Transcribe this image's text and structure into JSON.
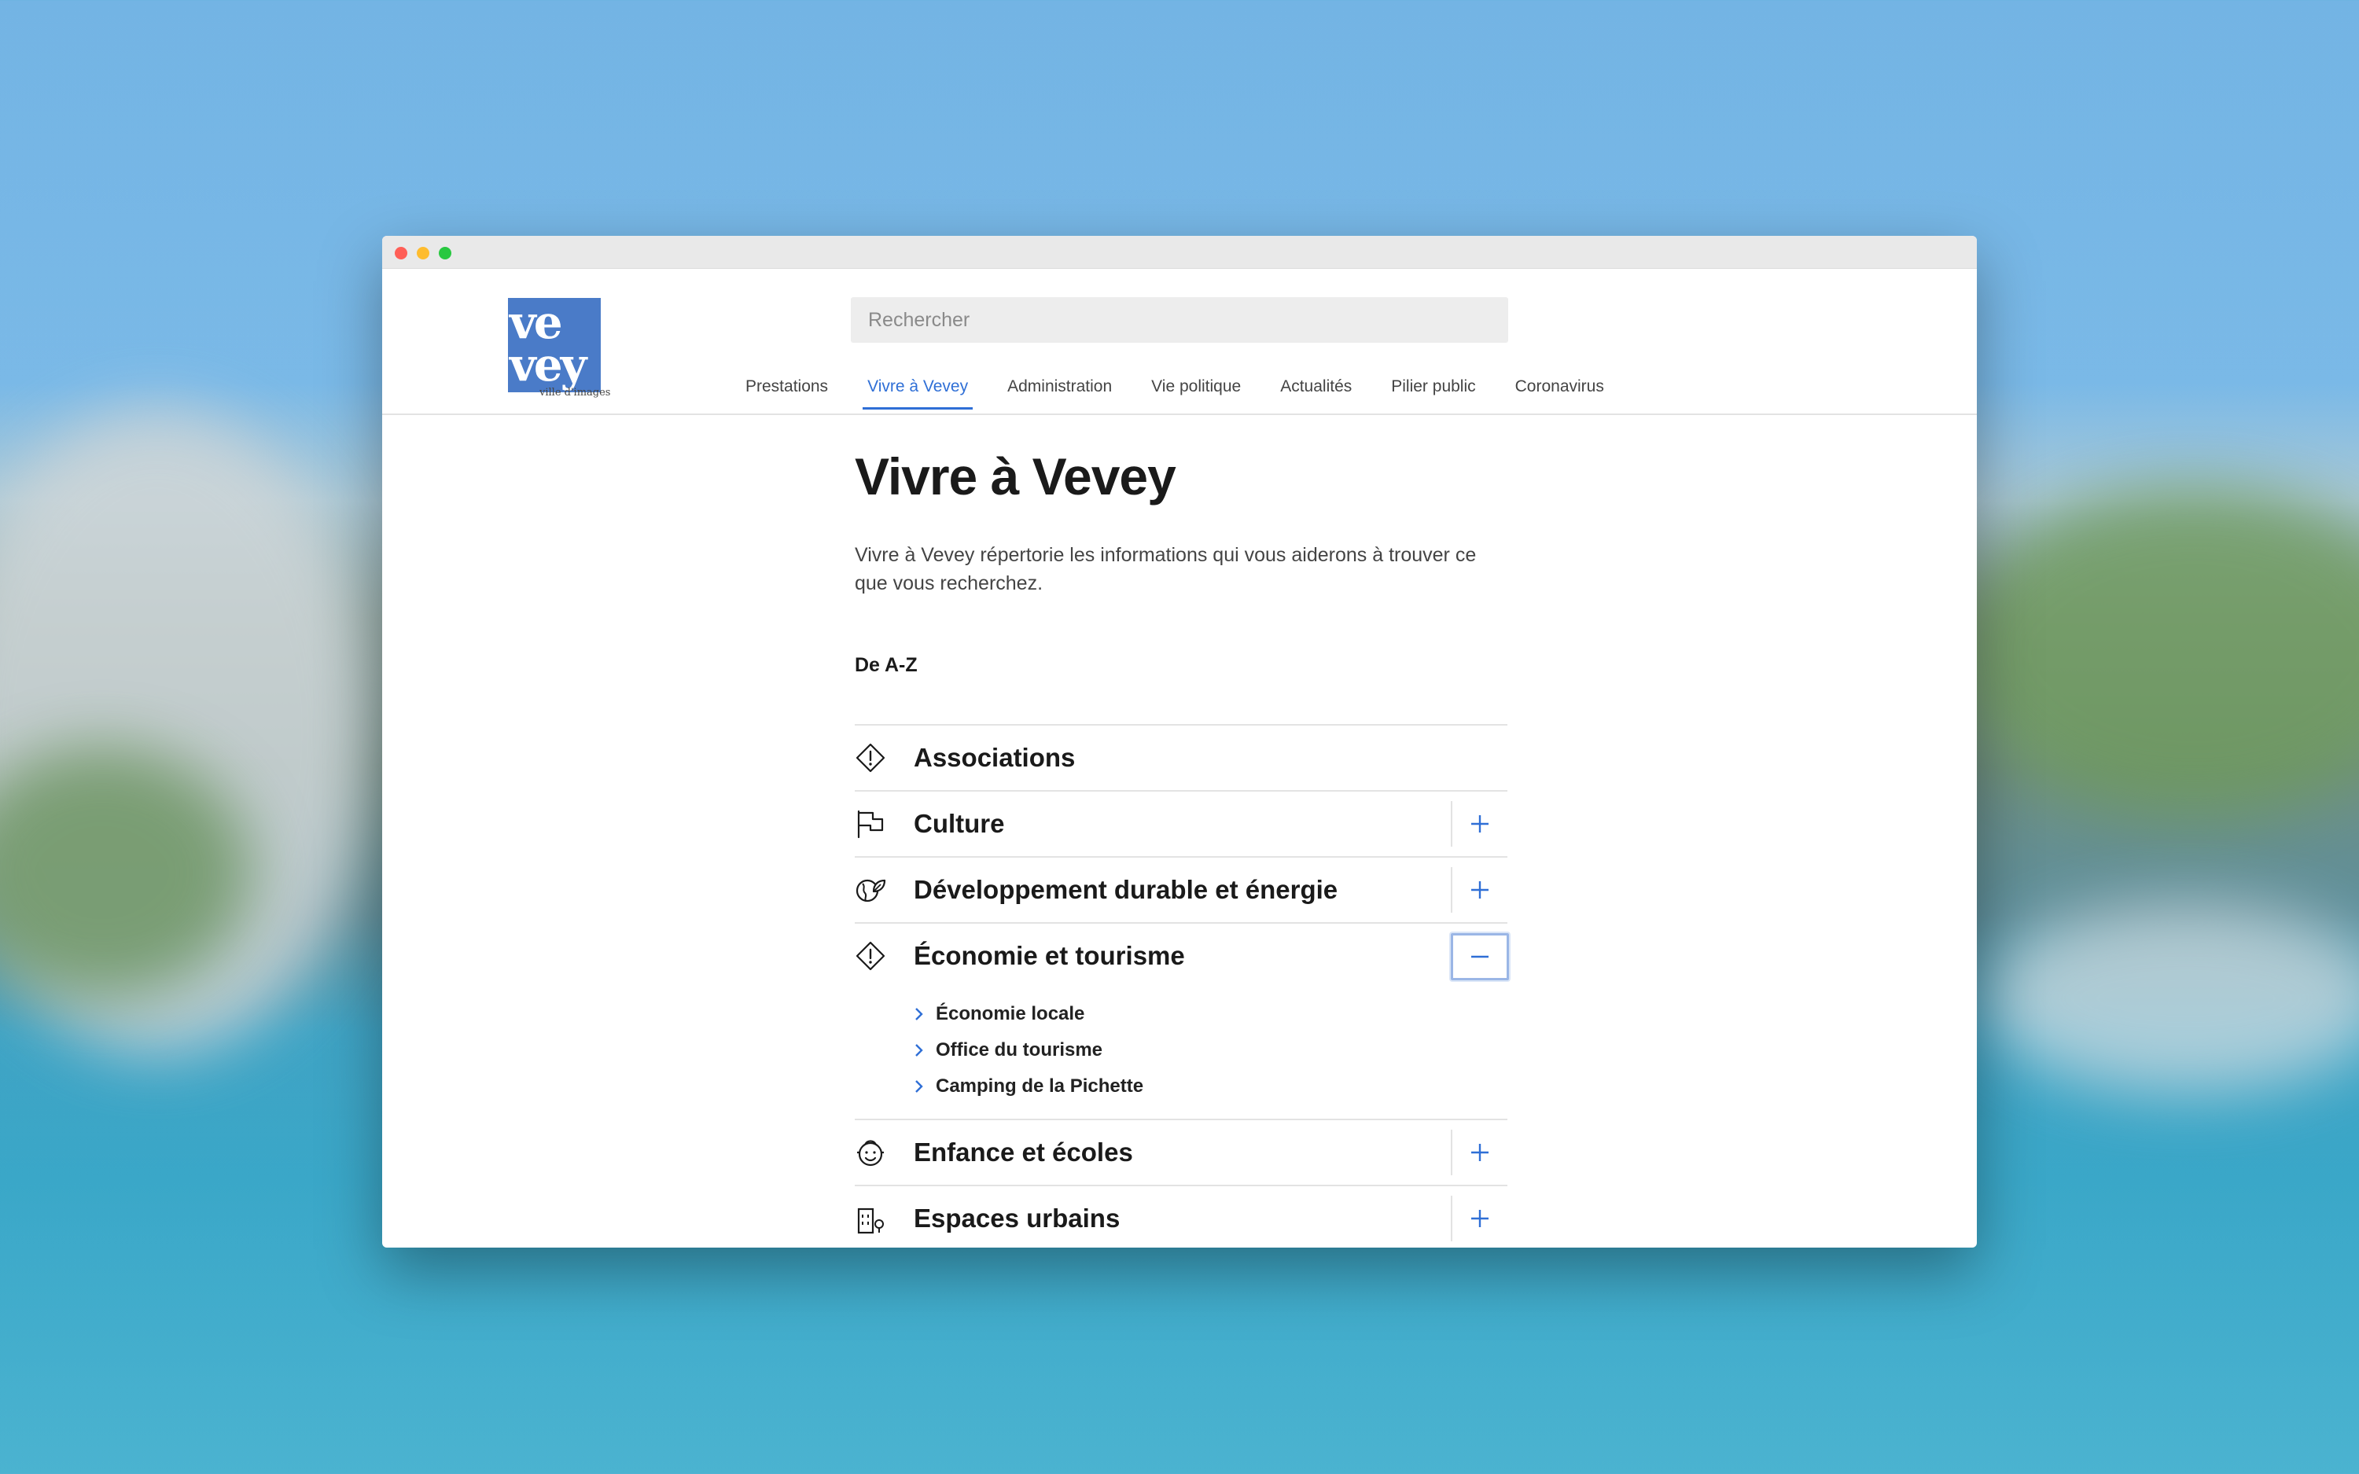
{
  "colors": {
    "accent": "#2f6fd6",
    "logo_bg": "#4a7bc8"
  },
  "logo": {
    "line1": "ve",
    "line2": "vey",
    "tagline": "ville d'images"
  },
  "search": {
    "placeholder": "Rechercher"
  },
  "nav": {
    "items": [
      {
        "label": "Prestations"
      },
      {
        "label": "Vivre à Vevey",
        "active": true
      },
      {
        "label": "Administration"
      },
      {
        "label": "Vie politique"
      },
      {
        "label": "Actualités"
      },
      {
        "label": "Pilier public"
      },
      {
        "label": "Coronavirus"
      }
    ]
  },
  "main": {
    "title": "Vivre à Vevey",
    "intro": "Vivre à Vevey répertorie  les informations qui vous aiderons à trouver ce que vous recherchez.",
    "az_label": "De A-Z",
    "sections": [
      {
        "title": "Associations",
        "icon": "alert-diamond-icon"
      },
      {
        "title": "Culture",
        "icon": "flag-icon",
        "toggle": "plus-icon"
      },
      {
        "title": "Développement durable et énergie",
        "icon": "leaf-globe-icon",
        "toggle": "plus-icon"
      },
      {
        "title": "Économie et tourisme",
        "icon": "alert-diamond-icon",
        "toggle": "minus-icon",
        "expanded": true,
        "items": [
          "Économie locale",
          "Office du tourisme",
          "Camping de la Pichette"
        ]
      },
      {
        "title": "Enfance et écoles",
        "icon": "child-face-icon",
        "toggle": "plus-icon"
      },
      {
        "title": "Espaces urbains",
        "icon": "building-tree-icon",
        "toggle": "plus-icon"
      }
    ]
  }
}
